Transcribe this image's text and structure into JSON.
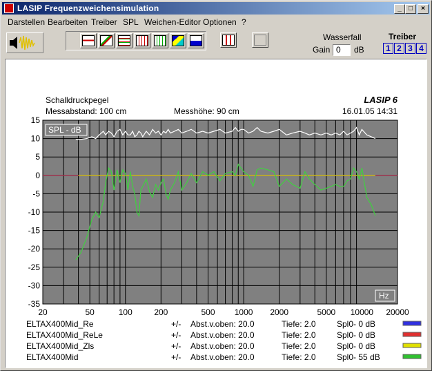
{
  "window": {
    "title": "LASIP  Frequenzweichensimulation"
  },
  "titlebar_buttons": {
    "minimize": "_",
    "maximize": "□",
    "close": "×"
  },
  "menu": [
    "Darstellen",
    "Bearbeiten",
    "Treiber",
    "SPL",
    "Weichen-Editor",
    "Optionen",
    "?"
  ],
  "toolbar": {
    "wasserfall_label": "Wasserfall",
    "gain_label": "Gain",
    "gain_value": "0",
    "gain_unit": "dB",
    "treiber_label": "Treiber",
    "treiber_buttons": [
      "1",
      "2",
      "3",
      "4"
    ]
  },
  "plot": {
    "header": {
      "title": "Schalldruckpegel",
      "messabstand": "Messabstand:  100  cm",
      "messhoehe": "Messhöhe:  90  cm",
      "logo": "LASIP 6",
      "datetime": "16.01.05  14:31"
    },
    "spl_tag": "SPL - dB",
    "hz_tag": "Hz",
    "legend": [
      {
        "name": "ELTAX400Mid_Re",
        "pm": "+/-",
        "abst": "Abst.v.oben: 20.0",
        "tiefe": "Tiefe: 2.0",
        "spl0": "Spl0- 0 dB",
        "color": "#3030e0"
      },
      {
        "name": "ELTAX400Mid_ReLe",
        "pm": "+/-",
        "abst": "Abst.v.oben: 20.0",
        "tiefe": "Tiefe: 2.0",
        "spl0": "Spl0- 0 dB",
        "color": "#e03030"
      },
      {
        "name": "ELTAX400Mid_Zls",
        "pm": "+/-",
        "abst": "Abst.v.oben: 20.0",
        "tiefe": "Tiefe: 2.0",
        "spl0": "Spl0- 0 dB",
        "color": "#e0e000"
      },
      {
        "name": "ELTAX400Mid",
        "pm": "+/-",
        "abst": "Abst.v.oben: 20.0",
        "tiefe": "Tiefe: 2.0",
        "spl0": "Spl0- 55 dB",
        "color": "#30c030"
      }
    ]
  },
  "chart_data": {
    "type": "line",
    "xscale": "log",
    "xlim": [
      20,
      20000
    ],
    "ylim": [
      -35,
      15
    ],
    "xticks": [
      "20",
      "50",
      "100",
      "200",
      "500",
      "1000",
      "2000",
      "5000",
      "10000",
      "20000"
    ],
    "yticks": [
      "15",
      "10",
      "5",
      "0",
      "-5",
      "-10",
      "-15",
      "-20",
      "-25",
      "-30",
      "-35"
    ],
    "grid": true,
    "background": "#808080",
    "series": [
      {
        "name": "ELTAX400Mid_Re",
        "color": "#3030e0",
        "x": [
          20,
          40,
          100,
          1000,
          13000,
          20000
        ],
        "y": [
          0,
          0,
          0,
          0,
          0,
          0
        ]
      },
      {
        "name": "ELTAX400Mid_ReLe",
        "color": "#c03030",
        "x": [
          20,
          20000
        ],
        "y": [
          0,
          0
        ]
      },
      {
        "name": "ELTAX400Mid_Zls",
        "color": "#e0e000",
        "x": [
          40,
          100,
          1000,
          13000
        ],
        "y": [
          0,
          0,
          0,
          0
        ]
      },
      {
        "name": "ELTAX400Mid",
        "color": "#40d040",
        "x": [
          38,
          42,
          47,
          52,
          56,
          60,
          65,
          68,
          72,
          76,
          80,
          85,
          90,
          95,
          100,
          105,
          110,
          115,
          120,
          125,
          130,
          135,
          140,
          150,
          160,
          170,
          180,
          190,
          200,
          210,
          220,
          230,
          240,
          260,
          280,
          300,
          330,
          360,
          400,
          450,
          500,
          560,
          630,
          700,
          800,
          850,
          900,
          950,
          1000,
          1100,
          1200,
          1300,
          1400,
          1600,
          1800,
          2000,
          2300,
          2600,
          3000,
          3300,
          3600,
          4000,
          4500,
          5000,
          5500,
          6000,
          6500,
          7000,
          7500,
          8000,
          8500,
          9000,
          9500,
          10000,
          11000,
          12000,
          13000
        ],
        "y": [
          -23,
          -21,
          -17,
          -12,
          -10,
          -11.5,
          -7,
          -2,
          2,
          1,
          -4,
          1.5,
          -2,
          1.5,
          0.5,
          -4,
          1,
          -3,
          -5,
          -10,
          -11,
          -4,
          -3,
          -1,
          -4.5,
          -6,
          -2.5,
          -4,
          -2,
          -1,
          -5,
          -6.5,
          -4,
          -2,
          1,
          -4,
          -2,
          0.5,
          -2,
          1,
          0,
          1,
          -1.5,
          0.5,
          1,
          0,
          3,
          2,
          1,
          0,
          -3,
          1.5,
          2,
          1.5,
          1,
          -3,
          -1,
          -2.5,
          -3.5,
          1,
          -1,
          -2.5,
          -4,
          -3.5,
          -3,
          -2.5,
          -3,
          -3,
          -1.5,
          -1,
          2,
          1,
          -1,
          2,
          -6,
          -8,
          -11
        ]
      },
      {
        "name": "SPL",
        "color": "#ffffff",
        "x": [
          38,
          42,
          47,
          52,
          56,
          60,
          65,
          68,
          72,
          76,
          80,
          85,
          90,
          95,
          100,
          105,
          110,
          115,
          120,
          125,
          130,
          135,
          140,
          150,
          160,
          170,
          180,
          190,
          200,
          210,
          220,
          230,
          240,
          260,
          280,
          300,
          330,
          360,
          400,
          450,
          500,
          560,
          630,
          700,
          800,
          850,
          900,
          950,
          1000,
          1100,
          1200,
          1300,
          1400,
          1600,
          1800,
          2000,
          2300,
          2600,
          3000,
          3300,
          3600,
          4000,
          4500,
          5000,
          5500,
          6000,
          6500,
          7000,
          7500,
          8000,
          8500,
          9000,
          9500,
          10000,
          11000,
          12000,
          13000
        ],
        "y": [
          9.8,
          9.8,
          10,
          10.5,
          10,
          11,
          12,
          11,
          12,
          11.5,
          10.5,
          12,
          12.5,
          11,
          12,
          11,
          11,
          12,
          10.5,
          11,
          12,
          11.5,
          10.5,
          12,
          11,
          12.5,
          11.5,
          12,
          11,
          12,
          11.5,
          12.5,
          11.5,
          12,
          12.5,
          11.5,
          12,
          12.5,
          11.5,
          12,
          11.5,
          12,
          12.5,
          11.5,
          12,
          13,
          12,
          12.5,
          12.5,
          11.5,
          12,
          13,
          12,
          11.5,
          12,
          12.5,
          11,
          11.5,
          12,
          11.5,
          11,
          11.5,
          11,
          11.5,
          11,
          11.5,
          11,
          12,
          11,
          11.5,
          12,
          13,
          11,
          12.5,
          11,
          10.5,
          10
        ]
      }
    ]
  }
}
